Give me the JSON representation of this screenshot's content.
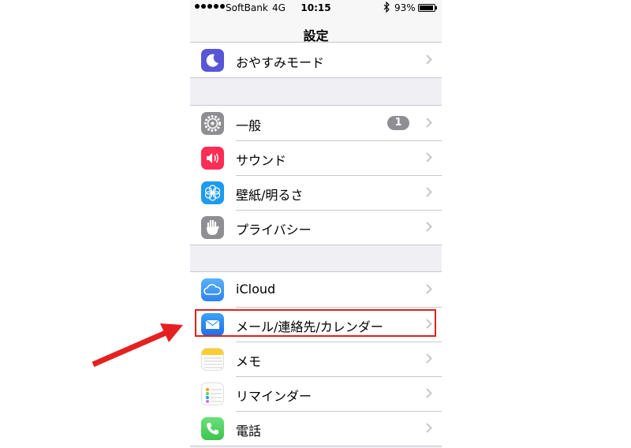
{
  "status_bar": {
    "carrier": "SoftBank",
    "network": "4G",
    "time": "10:15",
    "battery_percent": "93%"
  },
  "nav": {
    "title": "設定"
  },
  "groups": [
    {
      "items": [
        {
          "label": "おやすみモード",
          "icon": "moon-icon",
          "color": "#5856d6"
        }
      ]
    },
    {
      "items": [
        {
          "label": "一般",
          "icon": "gear-icon",
          "color": "#8e8e93",
          "badge": "1"
        },
        {
          "label": "サウンド",
          "icon": "speaker-icon",
          "color": "#ff2d55"
        },
        {
          "label": "壁紙/明るさ",
          "icon": "flower-icon",
          "color": "#1c9bf0"
        },
        {
          "label": "プライバシー",
          "icon": "hand-icon",
          "color": "#8e8e93"
        }
      ]
    },
    {
      "items": [
        {
          "label": "iCloud",
          "icon": "cloud-icon",
          "color": "#2f84f0"
        },
        {
          "label": "メール/連絡先/カレンダー",
          "icon": "mail-icon",
          "color": "#1f7ff0"
        },
        {
          "label": "メモ",
          "icon": "notes-icon",
          "color": "#fccd2e"
        },
        {
          "label": "リマインダー",
          "icon": "reminders-icon",
          "color": "#ffffff"
        },
        {
          "label": "電話",
          "icon": "phone-icon",
          "color": "#4cd964"
        }
      ]
    }
  ],
  "annotation": {
    "highlight_color": "#e02020"
  }
}
